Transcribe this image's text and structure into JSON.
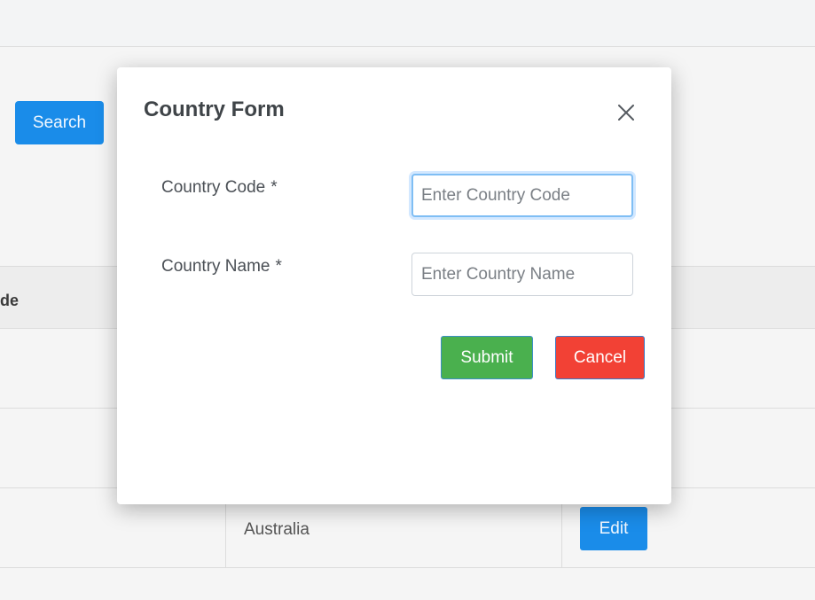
{
  "background": {
    "search_button": "Search",
    "table": {
      "header_partial": "de",
      "rows": [
        {
          "name": "",
          "action": ""
        },
        {
          "name": "",
          "action": ""
        },
        {
          "name": "Australia",
          "action": "Edit"
        }
      ]
    }
  },
  "modal": {
    "title": "Country Form",
    "close_icon": "close-icon",
    "fields": {
      "code": {
        "label": "Country Code",
        "required_mark": "*",
        "placeholder": "Enter Country Code",
        "value": ""
      },
      "name": {
        "label": "Country Name",
        "required_mark": "*",
        "placeholder": "Enter Country Name",
        "value": ""
      }
    },
    "buttons": {
      "submit": "Submit",
      "cancel": "Cancel"
    }
  },
  "colors": {
    "primary": "#1a8ce9",
    "submit": "#4ab04e",
    "cancel": "#f24135",
    "focus_ring": "#7fbef4"
  }
}
